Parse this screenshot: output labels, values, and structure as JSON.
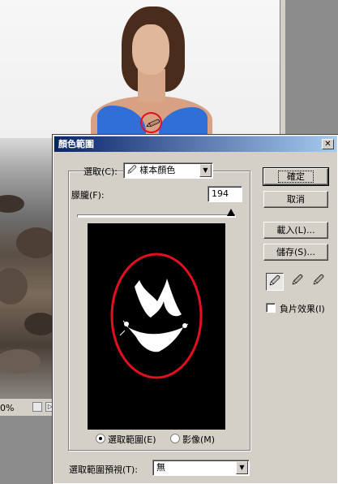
{
  "document": {
    "zoom": "0%",
    "status_button": "▷"
  },
  "dialog": {
    "title": "顏色範圍",
    "close_glyph": "✕",
    "select_label": "選取(C):",
    "select_value": "樣本顏色",
    "fuzziness_label": "朦朧(F):",
    "fuzziness_value": "194",
    "fuzziness_max": 200,
    "radio_selection": "選取範圍(E)",
    "radio_image": "影像(M)",
    "preview_label": "選取範圍預視(T):",
    "preview_value": "無",
    "buttons": {
      "ok": "確定",
      "cancel": "取消",
      "load": "載入(L)...",
      "save": "儲存(S)..."
    },
    "tools": {
      "eyedropper": "eyedropper-icon",
      "eyedropper_plus": "eyedropper-plus-icon",
      "eyedropper_minus": "eyedropper-minus-icon"
    },
    "invert_label": "負片效果(I)"
  },
  "colors": {
    "titlebar": "#0a246a",
    "highlight": "#e01020",
    "bikini": "#2f6fd6"
  }
}
